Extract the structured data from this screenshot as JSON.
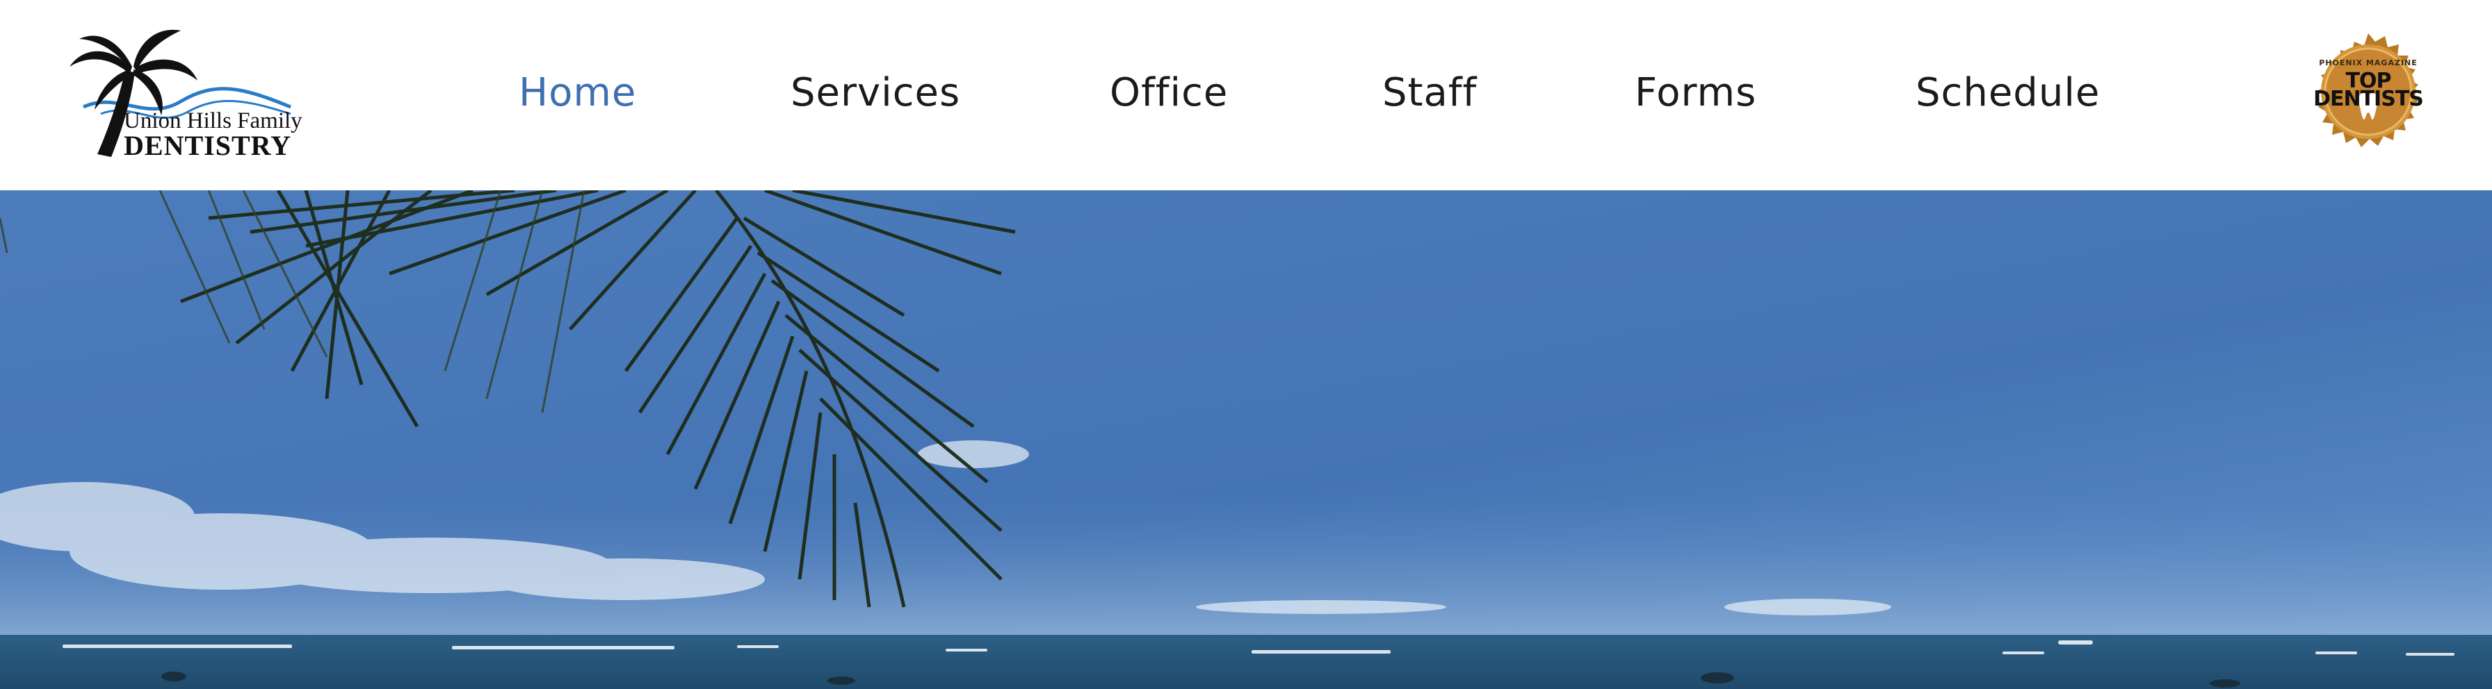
{
  "brand": {
    "line1": "Union Hills Family",
    "line2": "DENTISTRY"
  },
  "nav": {
    "items": [
      {
        "label": "Home",
        "active": true
      },
      {
        "label": "Services",
        "active": false
      },
      {
        "label": "Office",
        "active": false
      },
      {
        "label": "Staff",
        "active": false
      },
      {
        "label": "Forms",
        "active": false
      },
      {
        "label": "Schedule",
        "active": false
      }
    ]
  },
  "badge": {
    "line1": "PHOENIX MAGAZINE",
    "line2a": "TOP",
    "line2b": "DENTISTS"
  },
  "hero": {
    "image": "beach-ocean-palm-photo"
  },
  "colors": {
    "nav_active": "#3f6fb3",
    "nav_text": "#1b1b1b",
    "sky": "#4a79b8",
    "ocean": "#2c5d80",
    "badge_gold": "#c98a2e"
  }
}
